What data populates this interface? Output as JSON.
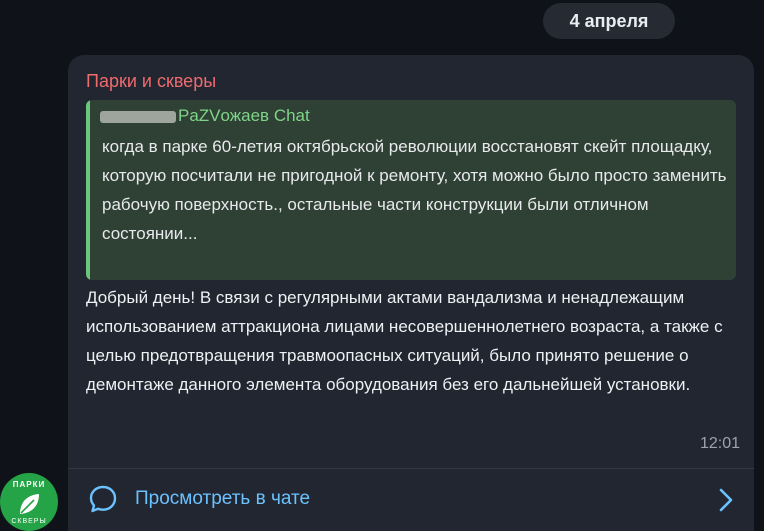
{
  "date_separator": "4 апреля",
  "message": {
    "sender_name": "Парки и скверы",
    "reply": {
      "author_suffix": "PaZVожаев Chat",
      "text": "когда в парке 60-летия октябрьской революции восстановят скейт площадку, которую посчитали не пригодной к ремонту, хотя можно было просто заменить рабочую поверхность., остальные части конструкции были отличном состоянии..."
    },
    "text": "Добрый день! В связи с регулярными актами вандализма и ненадлежащим использованием аттракциона лицами несовершеннолетнего возраста, а также с целью предотвращения травмоопасных ситуаций, было принято решение о демонтаже данного элемента оборудования без его дальнейшей установки.",
    "time": "12:01",
    "view_in_chat_label": "Просмотреть в чате"
  },
  "avatar": {
    "top_text": "ПАРКИ",
    "bottom_text": "СКВЕРЫ"
  },
  "colors": {
    "sender": "#ee6b6f",
    "reply_accent": "#6cc67a",
    "link": "#6cc1ff",
    "avatar_bg": "#24a446"
  },
  "icons": [
    "chat-bubble-icon",
    "chevron-right-icon",
    "leaf-icon"
  ]
}
